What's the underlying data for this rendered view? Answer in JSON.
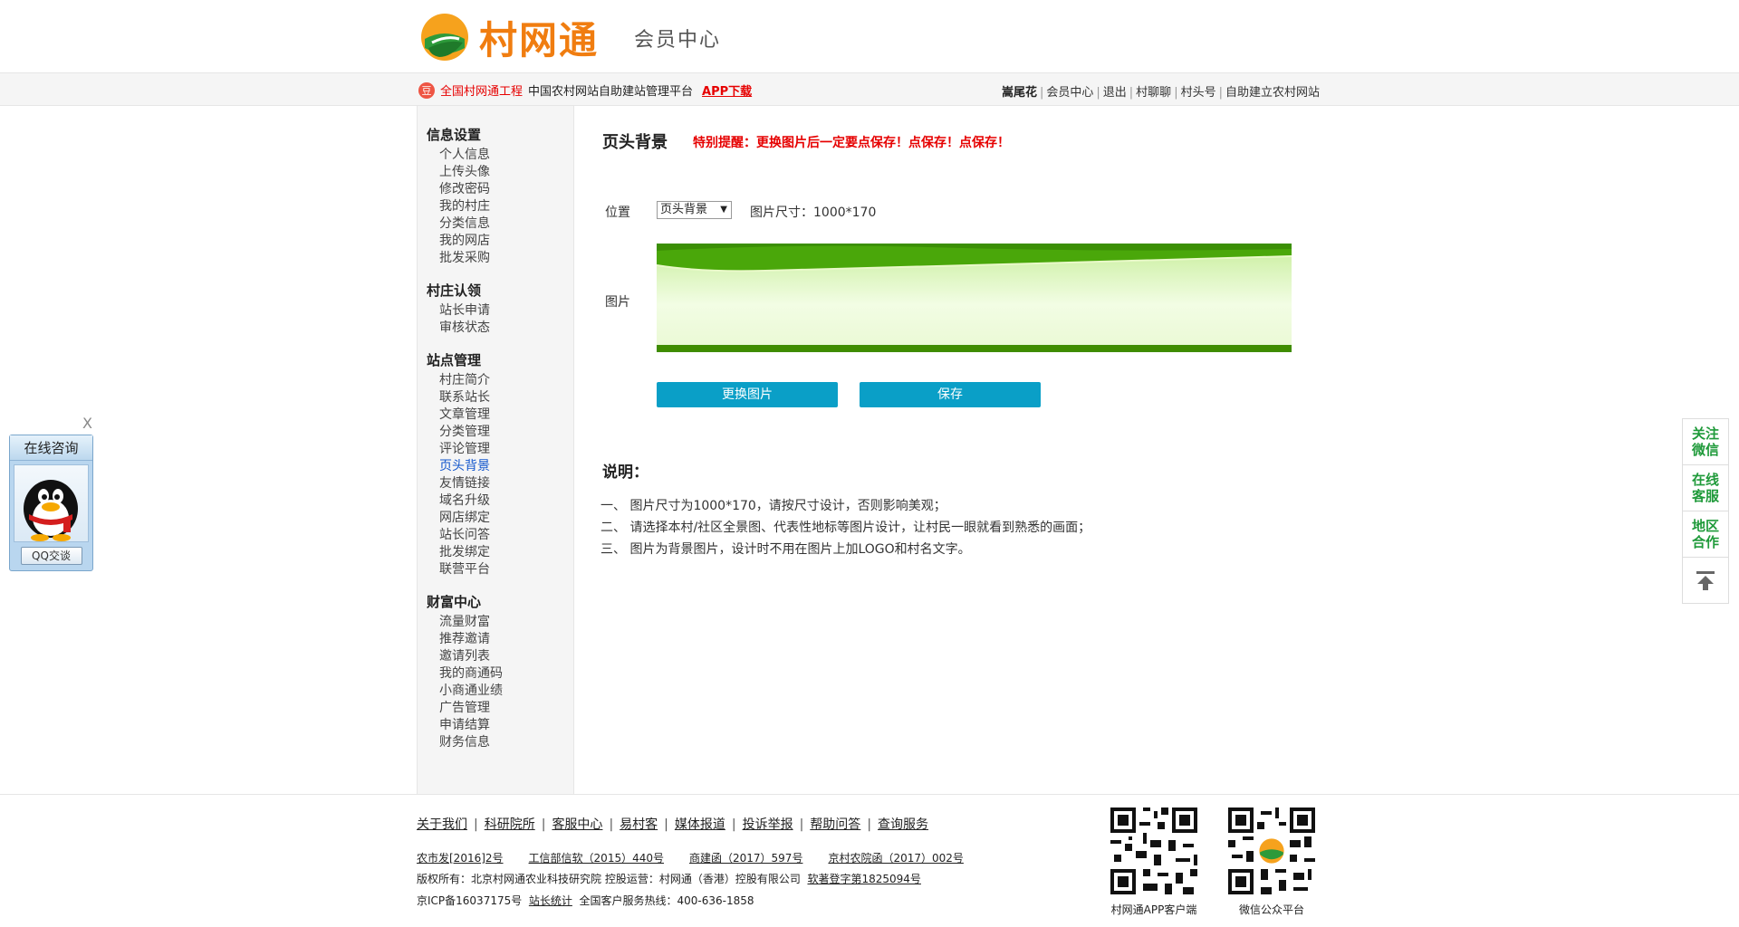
{
  "header": {
    "logo_text": "村网通",
    "subtitle": "会员中心"
  },
  "topbar": {
    "badge": "豆",
    "project": "全国村网通工程",
    "platform": "中国农村网站自助建站管理平台",
    "app_download": "APP下载",
    "username": "嵩尾花",
    "links": [
      "会员中心",
      "退出",
      "村聊聊",
      "村头号",
      "自助建立农村网站"
    ]
  },
  "sidebar": {
    "groups": [
      {
        "title": "信息设置",
        "items": [
          "个人信息",
          "上传头像",
          "修改密码",
          "我的村庄",
          "分类信息",
          "我的网店",
          "批发采购"
        ]
      },
      {
        "title": "村庄认领",
        "items": [
          "站长申请",
          "审核状态"
        ]
      },
      {
        "title": "站点管理",
        "items": [
          "村庄简介",
          "联系站长",
          "文章管理",
          "分类管理",
          "评论管理",
          "页头背景",
          "友情链接",
          "域名升级",
          "网店绑定",
          "站长问答",
          "批发绑定",
          "联营平台"
        ]
      },
      {
        "title": "财富中心",
        "items": [
          "流量财富",
          "推荐邀请",
          "邀请列表",
          "我的商通码",
          "小商通业绩",
          "广告管理",
          "申请结算",
          "财务信息"
        ]
      }
    ],
    "active": "页头背景"
  },
  "main": {
    "title": "页头背景",
    "warning": "特别提醒：更换图片后一定要点保存！点保存！点保存！",
    "position_label": "位置",
    "position_value": "页头背景",
    "image_size": "图片尺寸：1000*170",
    "image_label": "图片",
    "change_button": "更换图片",
    "save_button": "保存",
    "note_title": "说明：",
    "notes": [
      "一、 图片尺寸为1000*170，请按尺寸设计，否则影响美观；",
      "二、 请选择本村/社区全景图、代表性地标等图片设计，让村民一眼就看到熟悉的画面；",
      "三、 图片为背景图片，设计时不用在图片上加LOGO和村名文字。"
    ]
  },
  "footer": {
    "links": [
      "关于我们",
      "科研院所",
      "客服中心",
      "易村客",
      "媒体报道",
      "投诉举报",
      "帮助问答",
      "查询服务"
    ],
    "docs": [
      "农市发[2016]2号",
      "工信部信软（2015）440号",
      "商建函（2017）597号",
      "京村农院函（2017）002号"
    ],
    "copyright_prefix": "版权所有：北京村网通农业科技研究院  控股运营：村网通（香港）控股有限公司",
    "copyright_link": "软著登字第1825094号",
    "icp": "京ICP备16037175号",
    "stats": "站长统计",
    "hotline": "全国客户服务热线：400-636-1858",
    "qr1_label": "村网通APP客户端",
    "qr2_label": "微信公众平台"
  },
  "chat": {
    "close": "X",
    "title": "在线咨询",
    "button": "QQ交谈"
  },
  "float_right": {
    "items": [
      "关注微信",
      "在线客服",
      "地区合作"
    ]
  },
  "colors": {
    "accent_orange": "#f07d10",
    "warning_red": "#e60000",
    "button_blue": "#0a9fc7",
    "float_green": "#1f9a3a"
  }
}
